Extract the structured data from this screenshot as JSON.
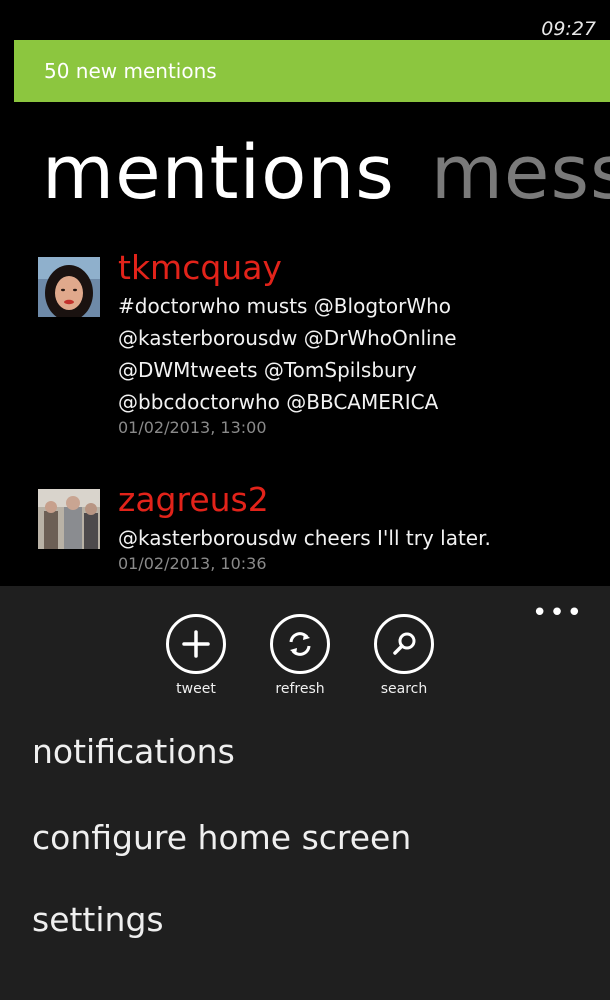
{
  "status": {
    "time": "09:27"
  },
  "banner": {
    "text": "50 new mentions"
  },
  "pivot": {
    "active": "mentions",
    "next": "mess"
  },
  "tweets": [
    {
      "author": "tkmcquay",
      "text": "#doctorwho musts @BlogtorWho\n@kasterborousdw @DrWhoOnline\n@DWMtweets @TomSpilsbury\n@bbcdoctorwho @BBCAMERICA",
      "time": "01/02/2013, 13:00"
    },
    {
      "author": "zagreus2",
      "text": "@kasterborousdw cheers I'll try later.",
      "time": "01/02/2013, 10:36"
    }
  ],
  "appbar": {
    "buttons": [
      {
        "label": "tweet",
        "icon": "plus-icon"
      },
      {
        "label": "refresh",
        "icon": "refresh-icon"
      },
      {
        "label": "search",
        "icon": "search-icon"
      }
    ],
    "more_icon": "ellipsis-icon",
    "menu": [
      "notifications",
      "configure home screen",
      "settings"
    ]
  },
  "colors": {
    "accent": "#8cc63f",
    "author": "#e2231a",
    "appbar": "#1f1f1f"
  }
}
